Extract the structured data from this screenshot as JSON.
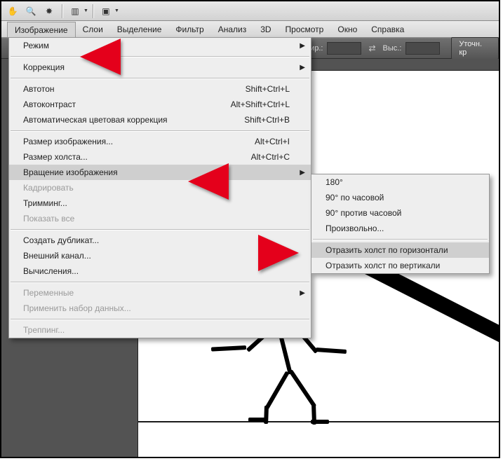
{
  "toolbar_icons": [
    "hand",
    "zoom",
    "rotate",
    "sep",
    "layout",
    "sep",
    "screen"
  ],
  "menubar": {
    "items": [
      {
        "label": "Изображение",
        "active": true
      },
      {
        "label": "Слои"
      },
      {
        "label": "Выделение"
      },
      {
        "label": "Фильтр"
      },
      {
        "label": "Анализ"
      },
      {
        "label": "3D"
      },
      {
        "label": "Просмотр"
      },
      {
        "label": "Окно"
      },
      {
        "label": "Справка"
      }
    ]
  },
  "options": {
    "width_label": "Шир.:",
    "height_label": "Выс.:",
    "refine_button": "Уточн. кр"
  },
  "dropdown": [
    {
      "type": "item",
      "label": "Режим",
      "submenu": true
    },
    {
      "type": "sep"
    },
    {
      "type": "item",
      "label": "Коррекция",
      "submenu": true
    },
    {
      "type": "sep"
    },
    {
      "type": "item",
      "label": "Автотон",
      "shortcut": "Shift+Ctrl+L"
    },
    {
      "type": "item",
      "label": "Автоконтраст",
      "shortcut": "Alt+Shift+Ctrl+L"
    },
    {
      "type": "item",
      "label": "Автоматическая цветовая коррекция",
      "shortcut": "Shift+Ctrl+B"
    },
    {
      "type": "sep"
    },
    {
      "type": "item",
      "label": "Размер изображения...",
      "shortcut": "Alt+Ctrl+I"
    },
    {
      "type": "item",
      "label": "Размер холста...",
      "shortcut": "Alt+Ctrl+C"
    },
    {
      "type": "item",
      "label": "Вращение изображения",
      "submenu": true,
      "highlight": true
    },
    {
      "type": "item",
      "label": "Кадрировать",
      "disabled": true
    },
    {
      "type": "item",
      "label": "Тримминг..."
    },
    {
      "type": "item",
      "label": "Показать все",
      "disabled": true
    },
    {
      "type": "sep"
    },
    {
      "type": "item",
      "label": "Создать дубликат..."
    },
    {
      "type": "item",
      "label": "Внешний канал..."
    },
    {
      "type": "item",
      "label": "Вычисления..."
    },
    {
      "type": "sep"
    },
    {
      "type": "item",
      "label": "Переменные",
      "submenu": true,
      "disabled": true
    },
    {
      "type": "item",
      "label": "Применить набор данных...",
      "disabled": true
    },
    {
      "type": "sep"
    },
    {
      "type": "item",
      "label": "Треппинг...",
      "disabled": true
    }
  ],
  "submenu": [
    {
      "type": "item",
      "label": "180°"
    },
    {
      "type": "item",
      "label": "90° по часовой"
    },
    {
      "type": "item",
      "label": "90° против часовой"
    },
    {
      "type": "item",
      "label": "Произвольно..."
    },
    {
      "type": "sep"
    },
    {
      "type": "item",
      "label": "Отразить холст по горизонтали",
      "highlight": true
    },
    {
      "type": "item",
      "label": "Отразить холст по вертикали"
    }
  ]
}
